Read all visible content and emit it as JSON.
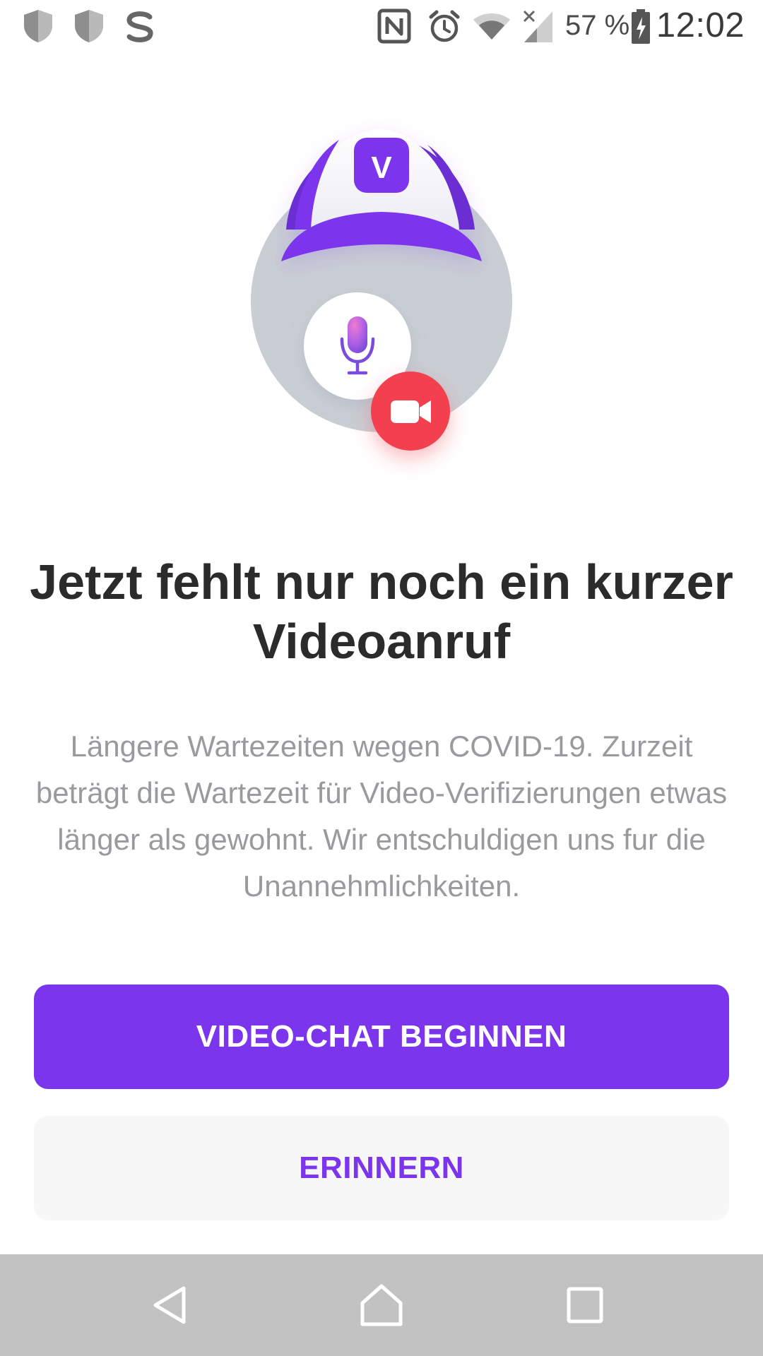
{
  "status_bar": {
    "battery_percent": "57 %",
    "time": "12:02",
    "icons": [
      "shield-icon",
      "shield-icon",
      "s-app-icon",
      "nfc-icon",
      "alarm-icon",
      "wifi-icon",
      "signal-icon",
      "battery-charging-icon"
    ]
  },
  "illustration": {
    "logo_letter": "V",
    "colors": {
      "brand_purple": "#7b35ec",
      "circle_gray": "#c9ced4",
      "record_red": "#f2414f"
    },
    "icons": [
      "cap-icon",
      "microphone-icon",
      "video-camera-icon"
    ]
  },
  "content": {
    "title": "Jetzt fehlt nur noch ein kurzer Videoanruf",
    "description": "Längere Wartezeiten wegen COVID-19. Zurzeit beträgt die Wartezeit für Video-Verifizierungen etwas länger als gewohnt. Wir entschuldigen uns fur die Unannehmlichkeiten."
  },
  "actions": {
    "primary_label": "VIDEO-CHAT BEGINNEN",
    "secondary_label": "ERINNERN"
  },
  "nav_bar": {
    "icons": [
      "back-icon",
      "home-icon",
      "recents-icon"
    ]
  }
}
